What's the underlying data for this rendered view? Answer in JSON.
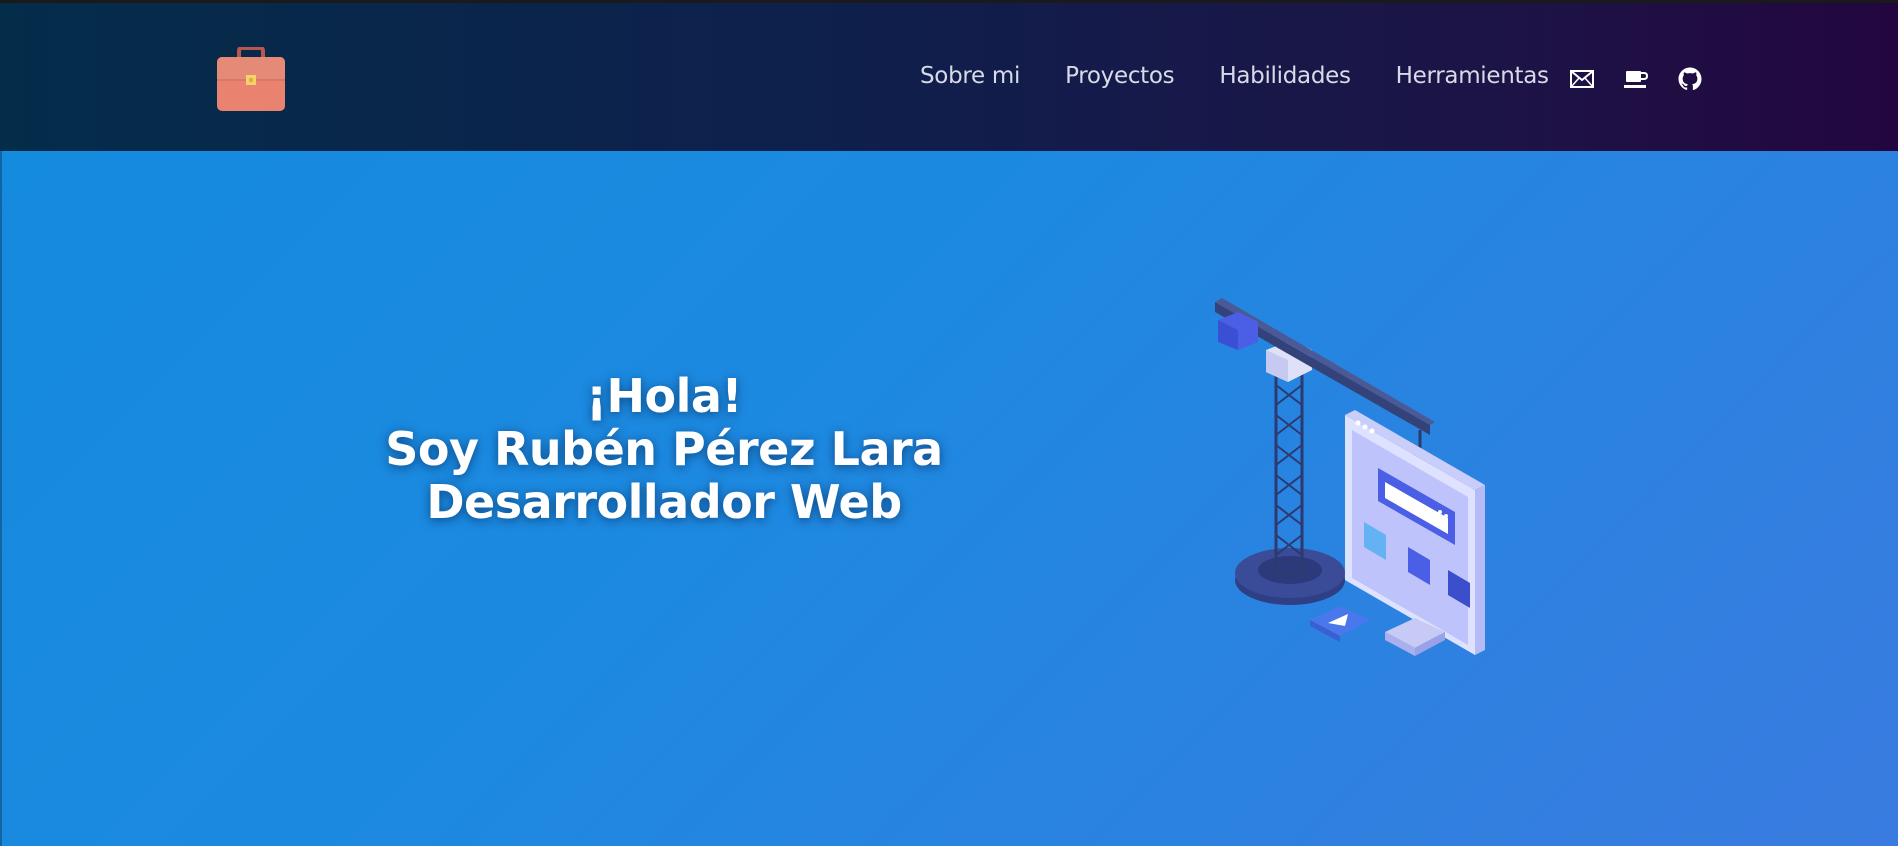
{
  "header": {
    "logo_icon": "briefcase-icon",
    "nav": [
      {
        "label": "Sobre mi"
      },
      {
        "label": "Proyectos"
      },
      {
        "label": "Habilidades"
      },
      {
        "label": "Herramientas"
      }
    ],
    "icons": [
      "mail-icon",
      "coffee-icon",
      "github-icon"
    ]
  },
  "hero": {
    "line1": "¡Hola!",
    "line2": "Soy Rubén Pérez Lara",
    "line3": "Desarrollador Web",
    "illustration": "construction-crane-website-illustration"
  },
  "colors": {
    "header_start": "#042d4a",
    "header_end": "#23063f",
    "hero_bg": "#1d89e0",
    "logo": "#e47f6a"
  }
}
